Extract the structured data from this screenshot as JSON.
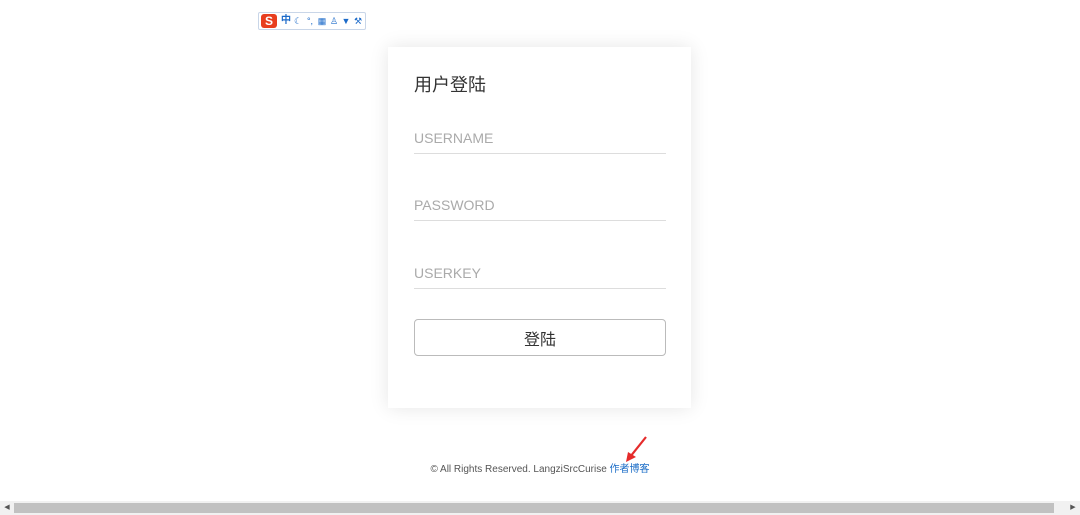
{
  "ime_toolbar": {
    "logo": "S",
    "mode_label": "中",
    "icons": [
      "moon-icon",
      "punctuation-icon",
      "keyboard-icon",
      "person-icon",
      "skin-icon",
      "wrench-icon"
    ]
  },
  "login": {
    "title": "用户登陆",
    "username_placeholder": "USERNAME",
    "password_placeholder": "PASSWORD",
    "userkey_placeholder": "USERKEY",
    "submit_label": "登陆"
  },
  "footer": {
    "copyright": "© All Rights Reserved. LangziSrcCurise ",
    "blog_link": "作者博客"
  },
  "colors": {
    "accent_link": "#1a6cc7",
    "arrow": "#e52b2b",
    "ime_logo": "#e83e1f"
  }
}
